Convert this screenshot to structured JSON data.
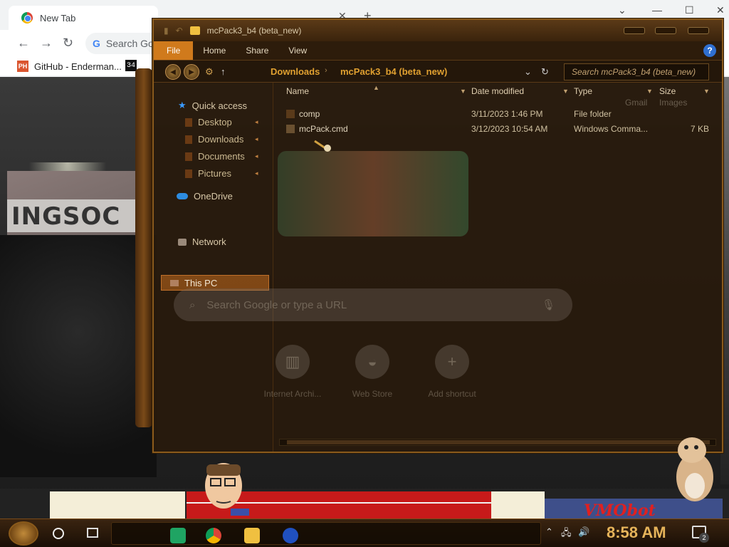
{
  "browser": {
    "tab_title": "New Tab",
    "tab_close": "✕",
    "new_tab": "+",
    "omnibox_placeholder": "Search Go",
    "bookmarks": [
      {
        "label": "GitHub - Enderman...",
        "logo": "PH"
      },
      {
        "label": "34"
      }
    ],
    "min": "—",
    "max": "☐",
    "close": "✕",
    "ghost_search_placeholder": "Search Google or type a URL",
    "shortcuts": [
      "Internet Archi...",
      "Web Store",
      "Add shortcut"
    ],
    "header_links": [
      "Gmail",
      "Images"
    ]
  },
  "explorer": {
    "title": "mcPack3_b4 (beta_new)",
    "ribbon_tabs": [
      "File",
      "Home",
      "Share",
      "View"
    ],
    "help": "?",
    "breadcrumb": [
      "Downloads",
      "mcPack3_b4 (beta_new)"
    ],
    "search_placeholder": "Search mcPack3_b4 (beta_new)",
    "nav": {
      "quick_access": "Quick access",
      "items": [
        "Desktop",
        "Downloads",
        "Documents",
        "Pictures"
      ],
      "onedrive": "OneDrive",
      "this_pc": "This PC",
      "network": "Network"
    },
    "columns": [
      "Name",
      "Date modified",
      "Type",
      "Size"
    ],
    "files": [
      {
        "name": "comp",
        "date": "3/11/2023 1:46 PM",
        "type": "File folder",
        "size": "",
        "icon": "folder-icon"
      },
      {
        "name": "mcPack.cmd",
        "date": "3/12/2023 10:54 AM",
        "type": "Windows Comma...",
        "size": "7 KB",
        "icon": "cmd-file-icon"
      }
    ]
  },
  "wallpaper": {
    "sign_text": "INGSOC",
    "banner_text": "VMObot"
  },
  "taskbar": {
    "clock": "8:58 AM",
    "notification_count": "2",
    "pinned_apps": [
      "sheets-icon",
      "chrome-icon",
      "file-explorer-icon",
      "sonic-icon"
    ]
  },
  "colors": {
    "accent": "#d07a1c",
    "crumb": "#e0a030",
    "clock": "#e6b45a"
  }
}
